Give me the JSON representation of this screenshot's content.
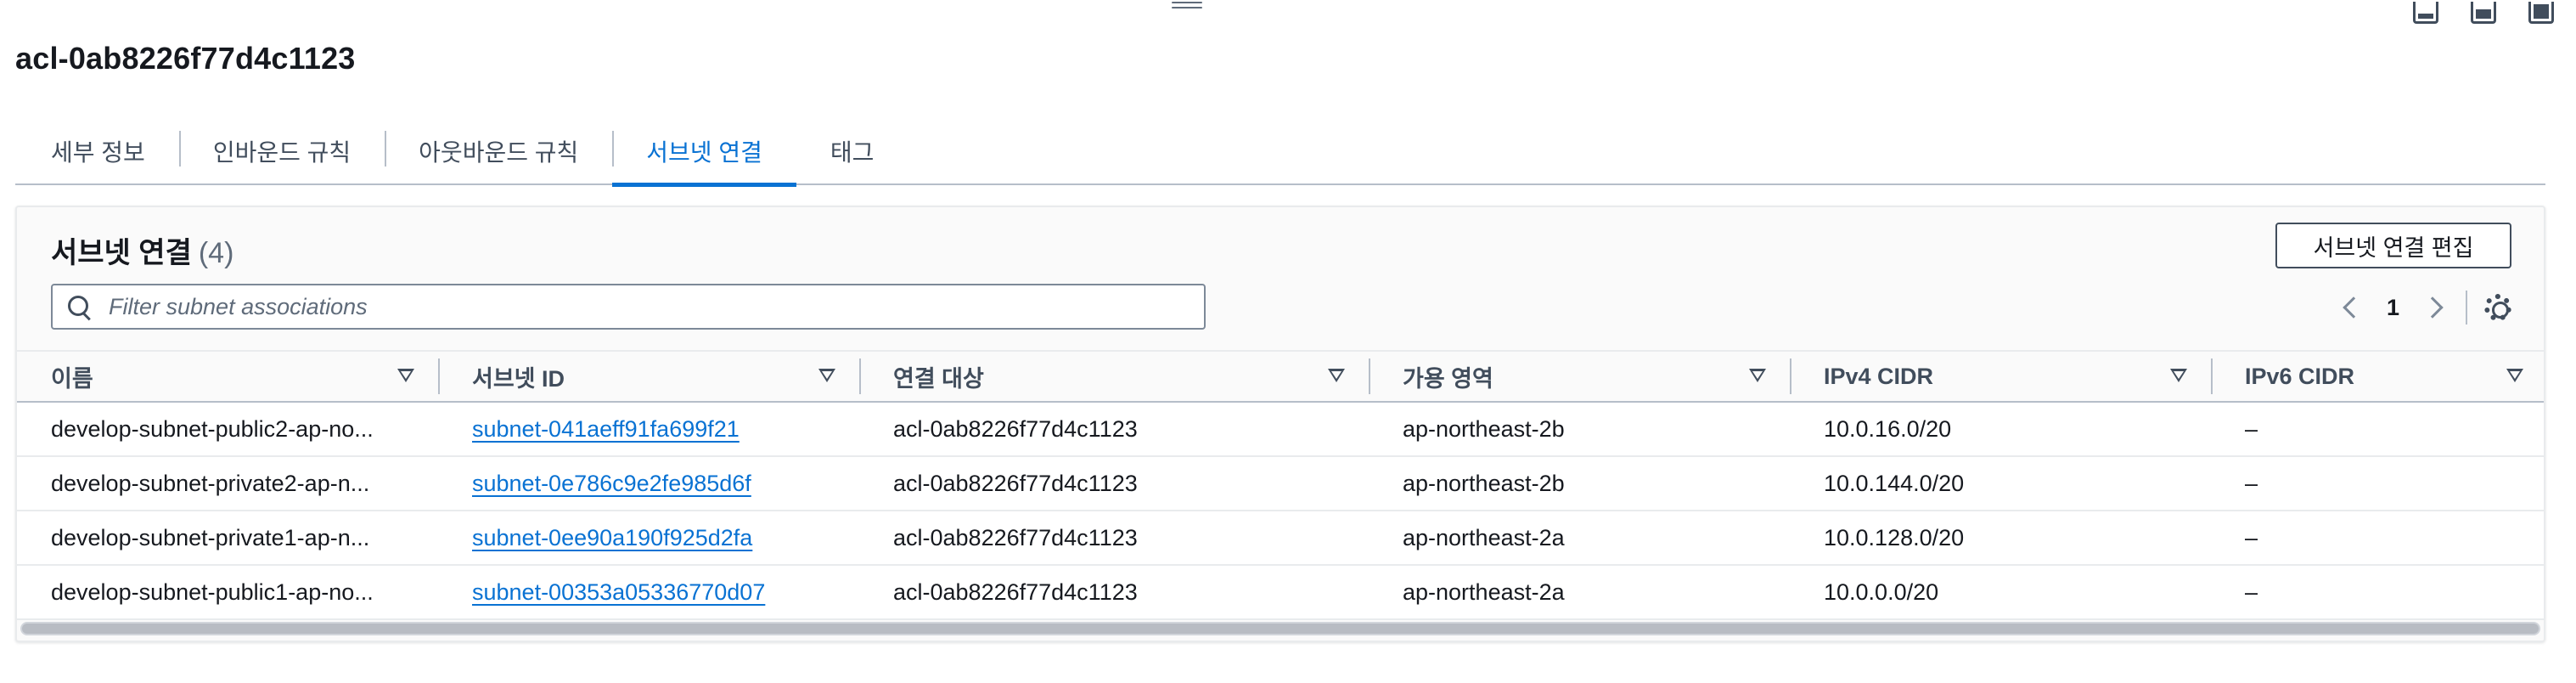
{
  "page_title": "acl-0ab8226f77d4c1123",
  "tabs": [
    {
      "label": "세부 정보"
    },
    {
      "label": "인바운드 규칙"
    },
    {
      "label": "아웃바운드 규칙"
    },
    {
      "label": "서브넷 연결",
      "active": true
    },
    {
      "label": "태그"
    }
  ],
  "panel": {
    "title": "서브넷 연결",
    "count": "(4)",
    "edit_button": "서브넷 연결 편집",
    "filter_placeholder": "Filter subnet associations",
    "page_number": "1"
  },
  "columns": [
    "이름",
    "서브넷 ID",
    "연결 대상",
    "가용 영역",
    "IPv4 CIDR",
    "IPv6 CIDR"
  ],
  "rows": [
    {
      "name": "develop-subnet-public2-ap-no...",
      "subnet_id": "subnet-041aeff91fa699f21",
      "associated_with": "acl-0ab8226f77d4c1123",
      "az": "ap-northeast-2b",
      "ipv4": "10.0.16.0/20",
      "ipv6": "–"
    },
    {
      "name": "develop-subnet-private2-ap-n...",
      "subnet_id": "subnet-0e786c9e2fe985d6f",
      "associated_with": "acl-0ab8226f77d4c1123",
      "az": "ap-northeast-2b",
      "ipv4": "10.0.144.0/20",
      "ipv6": "–"
    },
    {
      "name": "develop-subnet-private1-ap-n...",
      "subnet_id": "subnet-0ee90a190f925d2fa",
      "associated_with": "acl-0ab8226f77d4c1123",
      "az": "ap-northeast-2a",
      "ipv4": "10.0.128.0/20",
      "ipv6": "–"
    },
    {
      "name": "develop-subnet-public1-ap-no...",
      "subnet_id": "subnet-00353a05336770d07",
      "associated_with": "acl-0ab8226f77d4c1123",
      "az": "ap-northeast-2a",
      "ipv4": "10.0.0.0/20",
      "ipv6": "–"
    }
  ],
  "icons": {
    "drag_handle": "drag-handle-icon",
    "layout": [
      "layout-bottom-icon",
      "layout-half-icon",
      "layout-full-icon"
    ],
    "search": "search-icon",
    "prev": "chevron-left-icon",
    "next": "chevron-right-icon",
    "settings": "gear-icon",
    "sort": "sort-caret-icon"
  },
  "colors": {
    "accent": "#0972d3",
    "text": "#16191f",
    "muted": "#414d5c",
    "border": "#b6bec9"
  }
}
